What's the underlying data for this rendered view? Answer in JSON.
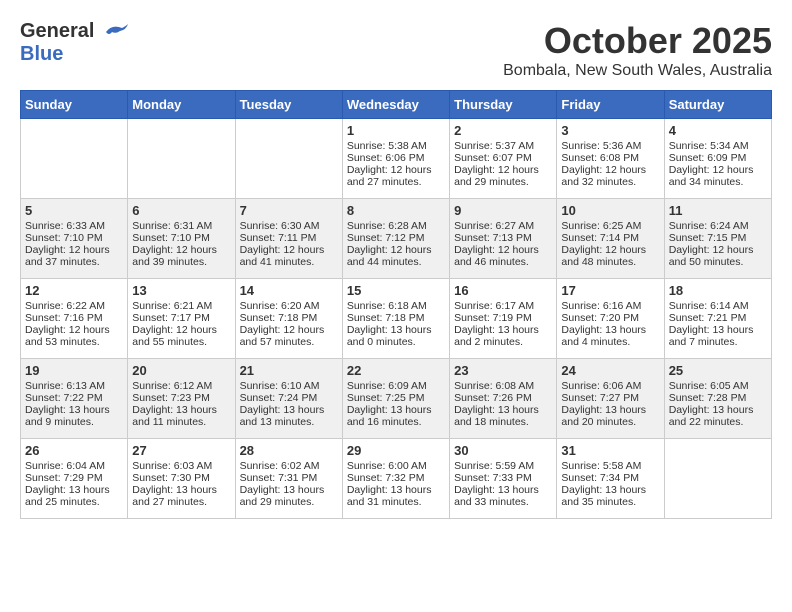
{
  "header": {
    "logo_general": "General",
    "logo_blue": "Blue",
    "month_title": "October 2025",
    "location": "Bombala, New South Wales, Australia"
  },
  "weekdays": [
    "Sunday",
    "Monday",
    "Tuesday",
    "Wednesday",
    "Thursday",
    "Friday",
    "Saturday"
  ],
  "weeks": [
    [
      {
        "day": "",
        "sunrise": "",
        "sunset": "",
        "daylight": ""
      },
      {
        "day": "",
        "sunrise": "",
        "sunset": "",
        "daylight": ""
      },
      {
        "day": "",
        "sunrise": "",
        "sunset": "",
        "daylight": ""
      },
      {
        "day": "1",
        "sunrise": "Sunrise: 5:38 AM",
        "sunset": "Sunset: 6:06 PM",
        "daylight": "Daylight: 12 hours and 27 minutes."
      },
      {
        "day": "2",
        "sunrise": "Sunrise: 5:37 AM",
        "sunset": "Sunset: 6:07 PM",
        "daylight": "Daylight: 12 hours and 29 minutes."
      },
      {
        "day": "3",
        "sunrise": "Sunrise: 5:36 AM",
        "sunset": "Sunset: 6:08 PM",
        "daylight": "Daylight: 12 hours and 32 minutes."
      },
      {
        "day": "4",
        "sunrise": "Sunrise: 5:34 AM",
        "sunset": "Sunset: 6:09 PM",
        "daylight": "Daylight: 12 hours and 34 minutes."
      }
    ],
    [
      {
        "day": "5",
        "sunrise": "Sunrise: 6:33 AM",
        "sunset": "Sunset: 7:10 PM",
        "daylight": "Daylight: 12 hours and 37 minutes."
      },
      {
        "day": "6",
        "sunrise": "Sunrise: 6:31 AM",
        "sunset": "Sunset: 7:10 PM",
        "daylight": "Daylight: 12 hours and 39 minutes."
      },
      {
        "day": "7",
        "sunrise": "Sunrise: 6:30 AM",
        "sunset": "Sunset: 7:11 PM",
        "daylight": "Daylight: 12 hours and 41 minutes."
      },
      {
        "day": "8",
        "sunrise": "Sunrise: 6:28 AM",
        "sunset": "Sunset: 7:12 PM",
        "daylight": "Daylight: 12 hours and 44 minutes."
      },
      {
        "day": "9",
        "sunrise": "Sunrise: 6:27 AM",
        "sunset": "Sunset: 7:13 PM",
        "daylight": "Daylight: 12 hours and 46 minutes."
      },
      {
        "day": "10",
        "sunrise": "Sunrise: 6:25 AM",
        "sunset": "Sunset: 7:14 PM",
        "daylight": "Daylight: 12 hours and 48 minutes."
      },
      {
        "day": "11",
        "sunrise": "Sunrise: 6:24 AM",
        "sunset": "Sunset: 7:15 PM",
        "daylight": "Daylight: 12 hours and 50 minutes."
      }
    ],
    [
      {
        "day": "12",
        "sunrise": "Sunrise: 6:22 AM",
        "sunset": "Sunset: 7:16 PM",
        "daylight": "Daylight: 12 hours and 53 minutes."
      },
      {
        "day": "13",
        "sunrise": "Sunrise: 6:21 AM",
        "sunset": "Sunset: 7:17 PM",
        "daylight": "Daylight: 12 hours and 55 minutes."
      },
      {
        "day": "14",
        "sunrise": "Sunrise: 6:20 AM",
        "sunset": "Sunset: 7:18 PM",
        "daylight": "Daylight: 12 hours and 57 minutes."
      },
      {
        "day": "15",
        "sunrise": "Sunrise: 6:18 AM",
        "sunset": "Sunset: 7:18 PM",
        "daylight": "Daylight: 13 hours and 0 minutes."
      },
      {
        "day": "16",
        "sunrise": "Sunrise: 6:17 AM",
        "sunset": "Sunset: 7:19 PM",
        "daylight": "Daylight: 13 hours and 2 minutes."
      },
      {
        "day": "17",
        "sunrise": "Sunrise: 6:16 AM",
        "sunset": "Sunset: 7:20 PM",
        "daylight": "Daylight: 13 hours and 4 minutes."
      },
      {
        "day": "18",
        "sunrise": "Sunrise: 6:14 AM",
        "sunset": "Sunset: 7:21 PM",
        "daylight": "Daylight: 13 hours and 7 minutes."
      }
    ],
    [
      {
        "day": "19",
        "sunrise": "Sunrise: 6:13 AM",
        "sunset": "Sunset: 7:22 PM",
        "daylight": "Daylight: 13 hours and 9 minutes."
      },
      {
        "day": "20",
        "sunrise": "Sunrise: 6:12 AM",
        "sunset": "Sunset: 7:23 PM",
        "daylight": "Daylight: 13 hours and 11 minutes."
      },
      {
        "day": "21",
        "sunrise": "Sunrise: 6:10 AM",
        "sunset": "Sunset: 7:24 PM",
        "daylight": "Daylight: 13 hours and 13 minutes."
      },
      {
        "day": "22",
        "sunrise": "Sunrise: 6:09 AM",
        "sunset": "Sunset: 7:25 PM",
        "daylight": "Daylight: 13 hours and 16 minutes."
      },
      {
        "day": "23",
        "sunrise": "Sunrise: 6:08 AM",
        "sunset": "Sunset: 7:26 PM",
        "daylight": "Daylight: 13 hours and 18 minutes."
      },
      {
        "day": "24",
        "sunrise": "Sunrise: 6:06 AM",
        "sunset": "Sunset: 7:27 PM",
        "daylight": "Daylight: 13 hours and 20 minutes."
      },
      {
        "day": "25",
        "sunrise": "Sunrise: 6:05 AM",
        "sunset": "Sunset: 7:28 PM",
        "daylight": "Daylight: 13 hours and 22 minutes."
      }
    ],
    [
      {
        "day": "26",
        "sunrise": "Sunrise: 6:04 AM",
        "sunset": "Sunset: 7:29 PM",
        "daylight": "Daylight: 13 hours and 25 minutes."
      },
      {
        "day": "27",
        "sunrise": "Sunrise: 6:03 AM",
        "sunset": "Sunset: 7:30 PM",
        "daylight": "Daylight: 13 hours and 27 minutes."
      },
      {
        "day": "28",
        "sunrise": "Sunrise: 6:02 AM",
        "sunset": "Sunset: 7:31 PM",
        "daylight": "Daylight: 13 hours and 29 minutes."
      },
      {
        "day": "29",
        "sunrise": "Sunrise: 6:00 AM",
        "sunset": "Sunset: 7:32 PM",
        "daylight": "Daylight: 13 hours and 31 minutes."
      },
      {
        "day": "30",
        "sunrise": "Sunrise: 5:59 AM",
        "sunset": "Sunset: 7:33 PM",
        "daylight": "Daylight: 13 hours and 33 minutes."
      },
      {
        "day": "31",
        "sunrise": "Sunrise: 5:58 AM",
        "sunset": "Sunset: 7:34 PM",
        "daylight": "Daylight: 13 hours and 35 minutes."
      },
      {
        "day": "",
        "sunrise": "",
        "sunset": "",
        "daylight": ""
      }
    ]
  ]
}
